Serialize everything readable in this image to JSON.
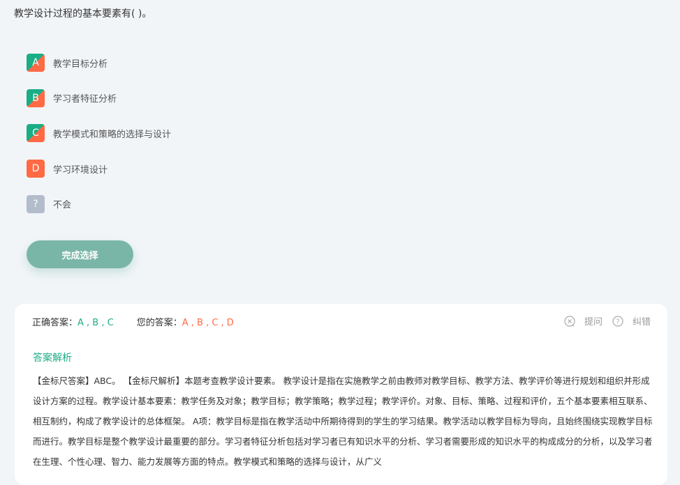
{
  "question": {
    "text": "教学设计过程的基本要素有( )。"
  },
  "options": [
    {
      "letter": "A",
      "text": "教学目标分析",
      "state": "correct-selected"
    },
    {
      "letter": "B",
      "text": "学习者特征分析",
      "state": "correct-selected"
    },
    {
      "letter": "C",
      "text": "教学模式和策略的选择与设计",
      "state": "correct-selected"
    },
    {
      "letter": "D",
      "text": "学习环境设计",
      "state": "wrong-selected"
    },
    {
      "letter": "?",
      "text": "不会",
      "state": "unknown"
    }
  ],
  "submit_label": "完成选择",
  "result": {
    "correct_label": "正确答案：",
    "correct_value": "A , B , C",
    "yours_label": "您的答案：",
    "yours_value": "A , B , C , D",
    "ask_label": "提问",
    "report_label": "纠错"
  },
  "analysis": {
    "title": "答案解析",
    "body": "【金标尺答案】ABC。 【金标尺解析】本题考查教学设计要素。 教学设计是指在实施教学之前由教师对教学目标、教学方法、教学评价等进行规划和组织并形成设计方案的过程。教学设计基本要素：教学任务及对象；教学目标；教学策略；教学过程；教学评价。对象、目标、策略、过程和评价，五个基本要素相互联系、相互制约，构成了教学设计的总体框架。 A项：教学目标是指在教学活动中所期待得到的学生的学习结果。教学活动以教学目标为导向，且始终围绕实现教学目标而进行。教学目标是整个教学设计最重要的部分。学习者特征分析包括对学习者已有知识水平的分析、学习者需要形成的知识水平的构成成分的分析，以及学习者在生理、个性心理、智力、能力发展等方面的特点。教学模式和策略的选择与设计，从广义"
  },
  "colors": {
    "correct": "#1aad86",
    "wrong": "#ff6a45",
    "unknown": "#b3bccb",
    "button": "#79b6a8"
  }
}
